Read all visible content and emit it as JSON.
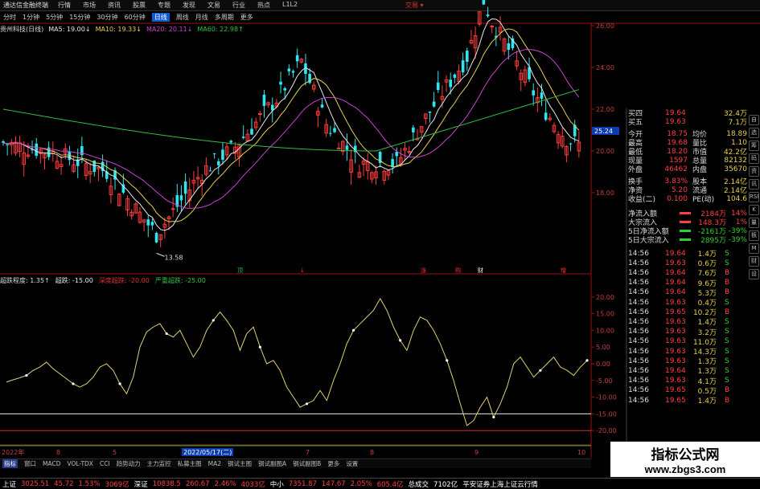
{
  "window": {
    "title": "通达信金融终端",
    "trade_label": "交易 ▾"
  },
  "menu": [
    "行情",
    "市场",
    "资讯",
    "股票",
    "专题",
    "发现",
    "文易",
    "行业",
    "热点",
    "L1L2"
  ],
  "periods": {
    "items": [
      "分时",
      "1分钟",
      "5分钟",
      "15分钟",
      "30分钟",
      "60分钟",
      "日线",
      "周线",
      "月线",
      "多周期",
      "更多"
    ],
    "active": "日线"
  },
  "ma_legend": {
    "stock": "贵州科技(日线)",
    "ma5": "MA5: 19.00↓",
    "ma10": "MA10: 19.33↓",
    "ma20": "MA20: 20.11↓",
    "ma60": "MA60: 22.98↑"
  },
  "indicator_legend": {
    "name": "超跌程度: 1.35↑",
    "d1": "超跌: -15.00",
    "d2": "深度超跌: -20.00",
    "d3": "严重超跌: -25.00"
  },
  "colors": {
    "up": "#ff3b3b",
    "down": "#2ee6f0",
    "ma5": "#e8e8e8",
    "ma10": "#e8d050",
    "ma20": "#d040d0",
    "ma60": "#30c040",
    "indicator": "#e0d070",
    "frame": "#9a1010"
  },
  "chart_data": {
    "type": "candlestick",
    "price_axis": {
      "ticks": [
        "26.00",
        "24.00",
        "22.00",
        "20.00",
        "18.00"
      ],
      "current_price_label": "25.24",
      "low_annotation": "13.58"
    },
    "signal_markers": [
      "顶",
      "↓",
      "涨",
      "购",
      "财",
      "增"
    ],
    "indicator": {
      "ticks": [
        "20.00",
        "15.00",
        "10.00",
        "5.00",
        "0.00",
        "-5.00",
        "-10.00",
        "-15.00",
        "-20.00"
      ],
      "ylim": [
        -20,
        25
      ],
      "values": [
        -5.5,
        -4.8,
        -4.2,
        -3.5,
        -2.0,
        -1.0,
        0.5,
        -1.5,
        -3.0,
        -4.5,
        -6.0,
        -7.0,
        -6.0,
        -4.0,
        -1.0,
        0.0,
        -2.0,
        -6.0,
        -9.0,
        -4.0,
        5.0,
        9.5,
        11.0,
        12.0,
        9.0,
        8.0,
        10.0,
        6.0,
        2.0,
        5.0,
        10.0,
        13.0,
        15.5,
        13.0,
        10.0,
        4.0,
        9.0,
        11.0,
        5.0,
        0.0,
        1.0,
        -2.0,
        -7.0,
        -10.0,
        -13.0,
        -12.0,
        -11.0,
        -8.0,
        -11.0,
        -5.0,
        0.0,
        6.0,
        10.0,
        12.0,
        14.0,
        16.0,
        19.5,
        16.0,
        11.0,
        7.0,
        4.0,
        10.0,
        14.0,
        13.0,
        10.0,
        6.0,
        1.0,
        -5.0,
        -12.0,
        -18.5,
        -17.0,
        -13.0,
        -10.0,
        -16.0,
        -12.0,
        -7.0,
        0.0,
        2.0,
        -1.0,
        -4.0,
        -2.0,
        0.0,
        2.0,
        -1.0,
        -2.0,
        -3.5,
        -1.0,
        1.0
      ]
    },
    "dates": {
      "items": [
        "2022年",
        "8",
        "5",
        "2022/05/17(二)",
        "7",
        "8",
        "9",
        "10"
      ],
      "active": "2022/05/17(二)"
    }
  },
  "quote": {
    "rows": [
      {
        "label": "买四",
        "price": "19.64",
        "vol": "32.4万",
        "color": "#ff4040"
      },
      {
        "label": "买五",
        "price": "19.63",
        "vol": "7.1万",
        "color": "#ff4040"
      },
      {
        "label": "今开",
        "value": "18.75",
        "label2": "均价",
        "value2": "18.89"
      },
      {
        "label": "最高",
        "value": "19.68",
        "label2": "量比",
        "value2": "1.10"
      },
      {
        "label": "最低",
        "value": "18.20",
        "label2": "市值",
        "value2": "42.2亿"
      },
      {
        "label": "现量",
        "value": "1597",
        "label2": "总量",
        "value2": "82132"
      },
      {
        "label": "外盘",
        "value": "46462",
        "label2": "内盘",
        "value2": "35670"
      },
      {
        "label": "换手",
        "value": "3.83%",
        "label2": "股本",
        "value2": "2.14亿"
      },
      {
        "label": "净资",
        "value": "5.20",
        "label2": "流通",
        "value2": "2.14亿"
      },
      {
        "label": "收益(二)",
        "value": "0.100",
        "label2": "PE(动)",
        "value2": "104.6"
      }
    ],
    "flows": [
      {
        "label": "净流入额",
        "value": "2184万",
        "pct": "14%",
        "color": "#ff4040"
      },
      {
        "label": "大宗流入",
        "value": "148.3万",
        "pct": "1%",
        "color": "#ff4040"
      },
      {
        "label": "5日净流入额",
        "value": "-2161万",
        "pct": "-39%",
        "color": "#30d030"
      },
      {
        "label": "5日大宗流入",
        "value": "2895万",
        "pct": "-39%",
        "color": "#30d030"
      }
    ],
    "ticks": [
      {
        "time": "14:56",
        "price": "19.64",
        "vol": "1.4万",
        "side": "S"
      },
      {
        "time": "14:56",
        "price": "19.63",
        "vol": "0.6万",
        "side": "S"
      },
      {
        "time": "14:56",
        "price": "19.64",
        "vol": "7.6万",
        "side": "B"
      },
      {
        "time": "14:56",
        "price": "19.64",
        "vol": "9.6万",
        "side": "B"
      },
      {
        "time": "14:56",
        "price": "19.64",
        "vol": "5.3万",
        "side": "B"
      },
      {
        "time": "14:56",
        "price": "19.63",
        "vol": "0.4万",
        "side": "S"
      },
      {
        "time": "14:56",
        "price": "19.65",
        "vol": "10.2万",
        "side": "B"
      },
      {
        "time": "14:56",
        "price": "19.63",
        "vol": "1.4万",
        "side": "S"
      },
      {
        "time": "14:56",
        "price": "19.63",
        "vol": "3.2万",
        "side": "S"
      },
      {
        "time": "14:56",
        "price": "19.63",
        "vol": "11.0万",
        "side": "S"
      },
      {
        "time": "14:56",
        "price": "19.63",
        "vol": "14.3万",
        "side": "S"
      },
      {
        "time": "14:56",
        "price": "19.63",
        "vol": "1.3万",
        "side": "S"
      },
      {
        "time": "14:56",
        "price": "19.64",
        "vol": "1.3万",
        "side": "S"
      },
      {
        "time": "14:56",
        "price": "19.63",
        "vol": "4.1万",
        "side": "S"
      },
      {
        "time": "14:56",
        "price": "19.65",
        "vol": "0.5万",
        "side": "B"
      },
      {
        "time": "14:56",
        "price": "19.65",
        "vol": "1.4万",
        "side": "B"
      }
    ]
  },
  "tabs": {
    "items": [
      "指标",
      "窗口",
      "MACD",
      "VOL-TDX",
      "CCI",
      "趋势动力",
      "主力监控",
      "私募主图",
      "MA2",
      "钢试主图",
      "钢试副图A",
      "钢试副图B",
      "更多",
      "设置"
    ],
    "active": "指标"
  },
  "status": [
    {
      "name": "上证",
      "a": "3025.51",
      "b": "45.72",
      "c": "1.53%",
      "d": "3069亿",
      "color": "#ff4040"
    },
    {
      "name": "深证",
      "a": "10838.5",
      "b": "260.67",
      "c": "2.46%",
      "d": "4033亿",
      "color": "#ff4040"
    },
    {
      "name": "中小",
      "a": "7351.87",
      "b": "147.67",
      "c": "2.05%",
      "d": "605.4亿",
      "color": "#ff4040"
    },
    {
      "name": "总成交",
      "a": "7102亿",
      "b": "平安证券上海上证云行情",
      "c": "",
      "d": "",
      "color": "#ffffff"
    }
  ],
  "watermark": {
    "title": "指标公式网",
    "url": "www.zbgs3.com"
  },
  "sidebar_icons": [
    "自",
    "选",
    "筹",
    "码",
    "资",
    "讯",
    "RSI",
    "K",
    "量",
    "板",
    "M",
    "财",
    "设"
  ]
}
